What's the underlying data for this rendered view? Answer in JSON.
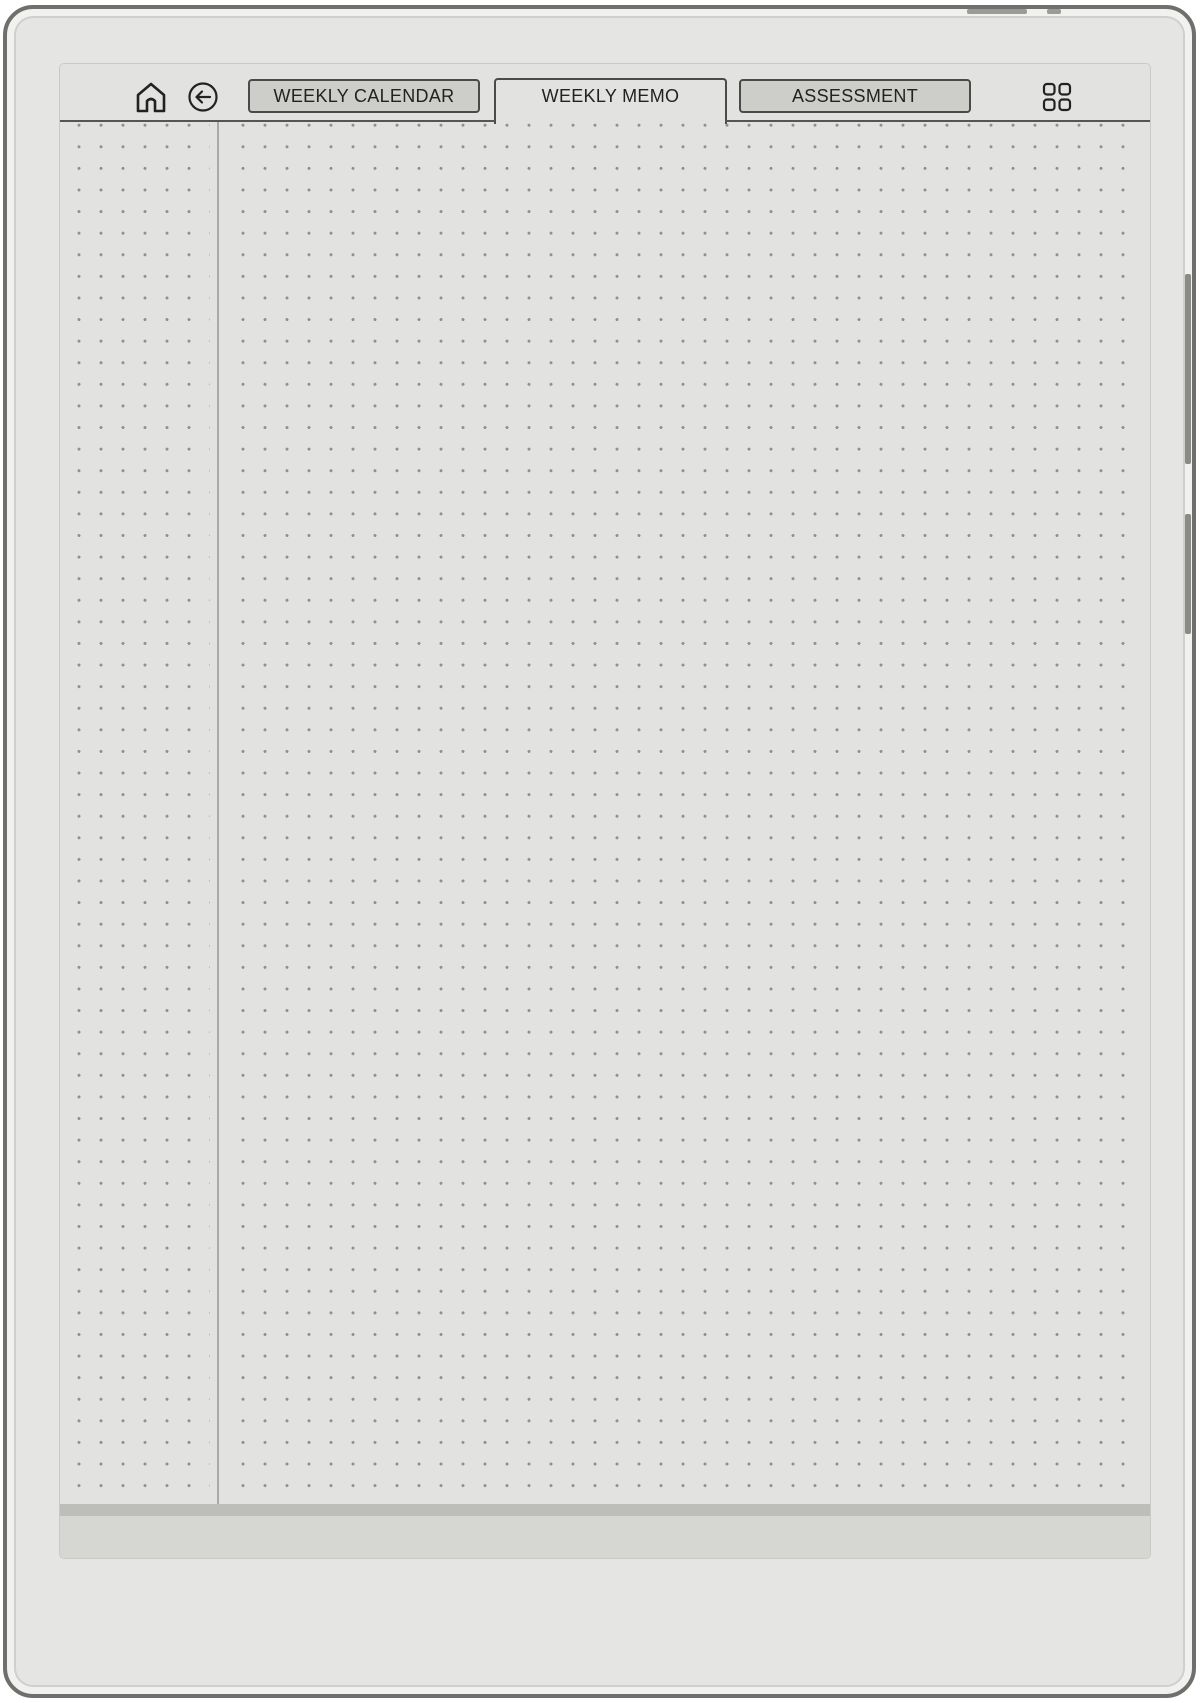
{
  "device": {
    "name": "e-paper tablet"
  },
  "toolbar": {
    "home_icon": "home-icon",
    "back_icon": "back-arrow-circle-icon",
    "grid_icon": "grid-icon",
    "tabs": [
      {
        "label": "WEEKLY CALENDAR",
        "active": false
      },
      {
        "label": "WEEKLY MEMO",
        "active": true
      },
      {
        "label": "ASSESSMENT",
        "active": false
      }
    ]
  },
  "page": {
    "style": "dot-grid",
    "dot_color": "#8f8f8c",
    "background_color": "#e2e2e0",
    "columns": [
      "narrow-left",
      "main"
    ]
  }
}
